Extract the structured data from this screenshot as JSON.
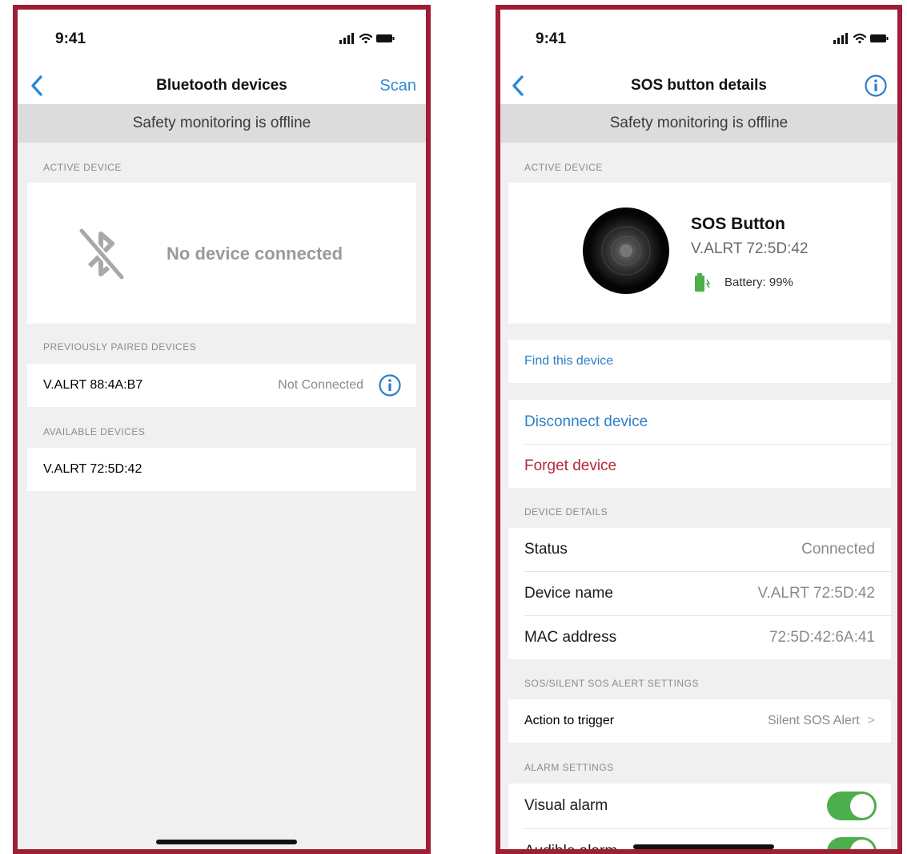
{
  "left": {
    "status": {
      "time": "9:41"
    },
    "nav": {
      "title": "Bluetooth devices",
      "action": "Scan"
    },
    "banner": "Safety monitoring is offline",
    "active_header": "ACTIVE DEVICE",
    "active_empty": "No device connected",
    "paired_header": "PREVIOUSLY PAIRED DEVICES",
    "paired": [
      {
        "name": "V.ALRT 88:4A:B7",
        "status": "Not Connected"
      }
    ],
    "available_header": "AVAILABLE DEVICES",
    "available": [
      {
        "name": "V.ALRT 72:5D:42"
      }
    ]
  },
  "right": {
    "status": {
      "time": "9:41"
    },
    "nav": {
      "title": "SOS button details"
    },
    "banner": "Safety monitoring is offline",
    "active_header": "ACTIVE DEVICE",
    "device": {
      "name": "SOS Button",
      "id": "V.ALRT 72:5D:42",
      "battery": "Battery: 99%"
    },
    "find": "Find this device",
    "disconnect": "Disconnect device",
    "forget": "Forget device",
    "details_header": "DEVICE DETAILS",
    "details": [
      {
        "label": "Status",
        "value": "Connected"
      },
      {
        "label": "Device name",
        "value": "V.ALRT 72:5D:42"
      },
      {
        "label": "MAC address",
        "value": "72:5D:42:6A:41"
      }
    ],
    "sos_header": "SOS/SILENT SOS ALERT SETTINGS",
    "action": {
      "label": "Action to trigger",
      "value": "Silent SOS Alert",
      "chevron": ">"
    },
    "alarm_header": "ALARM SETTINGS",
    "alarms": [
      {
        "label": "Visual alarm",
        "on": true
      },
      {
        "label": "Audible alarm",
        "on": true
      }
    ]
  },
  "colors": {
    "frame": "#a01d36",
    "link": "#2e7fc6",
    "danger": "#b42838",
    "toggle_on": "#4cae4c",
    "battery": "#4cae4c"
  },
  "icons": {
    "back": "chevron-left-icon",
    "info": "info-circle-icon",
    "bluetooth_off": "bluetooth-off-icon",
    "battery": "battery-icon",
    "signal": "cellular-signal-icon",
    "wifi": "wifi-icon",
    "battery_status": "battery-status-icon"
  }
}
